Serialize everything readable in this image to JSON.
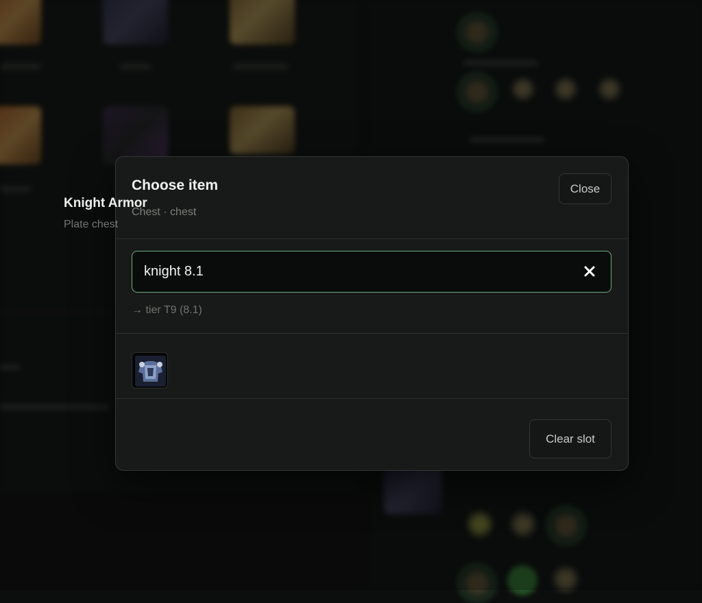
{
  "modal": {
    "title": "Choose item",
    "subtitle": "Chest · chest",
    "close_label": "Close",
    "search": {
      "value": "knight 8.1",
      "clear_icon": "close-icon"
    },
    "hint": "→ tier T9 (8.1)",
    "results": [
      {
        "name": "Knight Armor",
        "type": "Plate chest",
        "icon": "knight-armor-thumbnail"
      }
    ],
    "clear_slot_label": "Clear slot"
  },
  "colors": {
    "accent_border": "#6fae86",
    "modal_bg": "#171a18",
    "page_bg": "#0c0e0d"
  }
}
